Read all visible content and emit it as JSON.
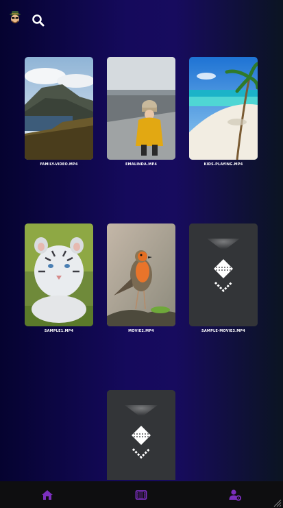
{
  "header": {
    "avatar_icon": "detective-avatar-icon",
    "search_icon": "search-icon"
  },
  "videos": [
    {
      "label": "FAMILY-VIDEO.MP4",
      "thumbnail": "mountain-lake-photo"
    },
    {
      "label": "EMALINDA.MP4",
      "thumbnail": "child-yellow-jacket-photo"
    },
    {
      "label": "KIDS-PLAYING.MP4",
      "thumbnail": "tropical-beach-photo"
    },
    {
      "label": "SAMPLE1.MP4",
      "thumbnail": "white-tiger-cub-photo"
    },
    {
      "label": "MOVIE2.MP4",
      "thumbnail": "robin-bird-photo"
    },
    {
      "label": "SAMPLE-MOVIE3.MP4",
      "thumbnail": "video-placeholder-icon"
    },
    {
      "label": "",
      "thumbnail": "video-placeholder-icon"
    }
  ],
  "bottom_nav": {
    "items": [
      {
        "name": "home",
        "icon": "home-icon"
      },
      {
        "name": "videos",
        "icon": "film-icon"
      },
      {
        "name": "profile",
        "icon": "user-settings-icon"
      }
    ],
    "accent_color": "#7b2fbe"
  },
  "colors": {
    "background_start": "#050330",
    "background_mid": "#170b5e",
    "background_end": "#0b1422",
    "placeholder_card": "#333538",
    "nav_bar": "#0e0e10"
  }
}
